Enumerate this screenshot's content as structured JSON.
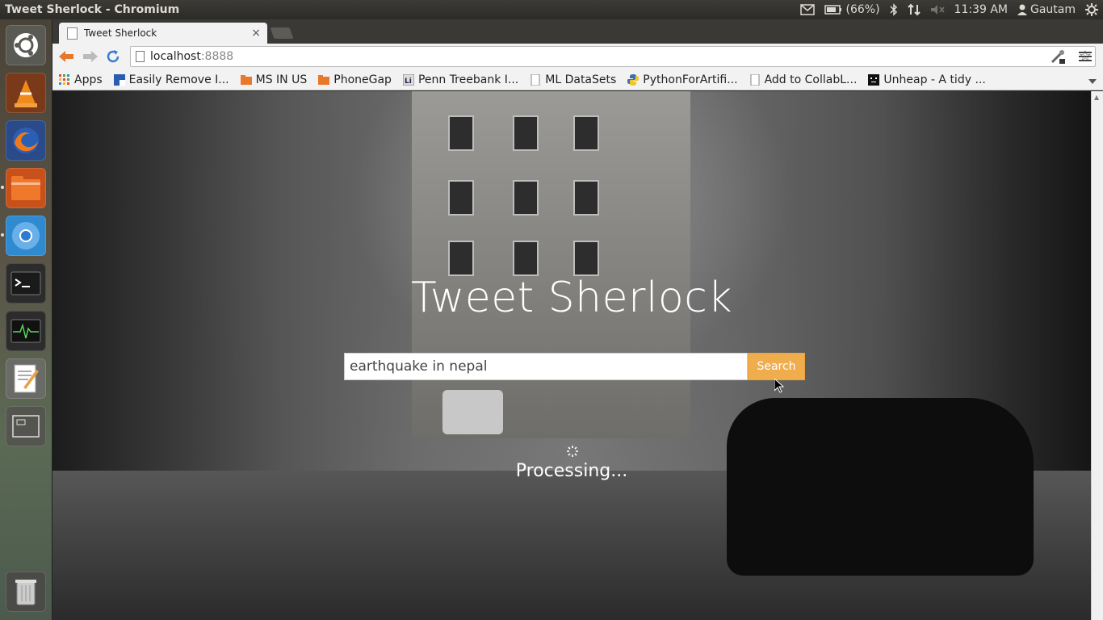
{
  "window": {
    "title": "Tweet Sherlock - Chromium"
  },
  "panel": {
    "battery": "(66%)",
    "time": "11:39 AM",
    "user": "Gautam"
  },
  "browser": {
    "tab_title": "Tweet Sherlock",
    "close_glyph": "×",
    "address": {
      "host": "localhost",
      "port": ":8888"
    },
    "bookmarks": [
      {
        "label": "Apps",
        "icon": "apps-grid-icon"
      },
      {
        "label": "Easily Remove I...",
        "icon": "bookmark-blue-icon"
      },
      {
        "label": "MS  IN  US",
        "icon": "folder-icon"
      },
      {
        "label": "PhoneGap",
        "icon": "folder-icon"
      },
      {
        "label": "Penn Treebank I...",
        "icon": "li-icon"
      },
      {
        "label": "ML DataSets",
        "icon": "page-icon"
      },
      {
        "label": "PythonForArtifi...",
        "icon": "python-icon"
      },
      {
        "label": "Add to CollabL...",
        "icon": "page-icon"
      },
      {
        "label": "Unheap - A tidy ...",
        "icon": "unheap-icon"
      }
    ]
  },
  "page": {
    "title": "Tweet Sherlock",
    "search": {
      "value": "earthquake in nepal",
      "button": "Search"
    },
    "status": "Processing..."
  },
  "colors": {
    "accent": "#f0ad4e",
    "panel": "#3c3b37"
  }
}
